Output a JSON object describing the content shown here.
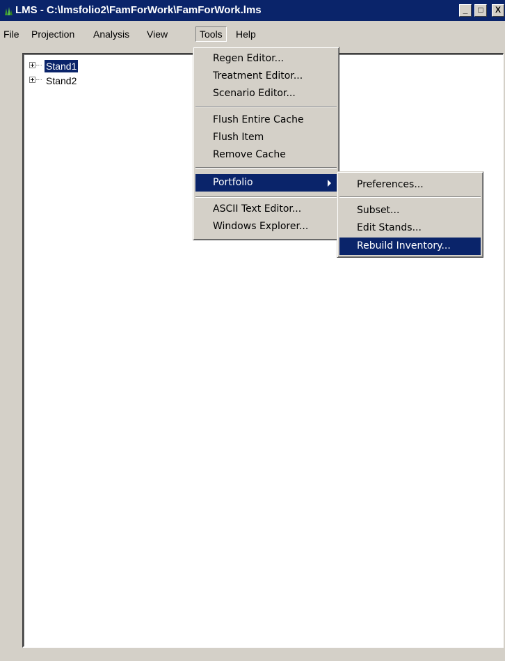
{
  "window": {
    "title": "LMS - C:\\lmsfolio2\\FamForWork\\FamForWork.lms",
    "app_icon": "lms-tree-icon",
    "minimize_label": "_",
    "maximize_label": "□",
    "close_label": "X"
  },
  "menubar": {
    "items": [
      "File",
      "Projection",
      "Analysis",
      "View",
      "Tools",
      "Help"
    ],
    "open_menu": "Tools"
  },
  "tree": {
    "nodes": [
      {
        "label": "Stand1",
        "selected": true
      },
      {
        "label": "Stand2",
        "selected": false
      }
    ]
  },
  "tools_menu": {
    "group1": [
      "Regen Editor...",
      "Treatment Editor...",
      "Scenario Editor..."
    ],
    "group2": [
      "Flush Entire Cache",
      "Flush Item",
      "Remove Cache"
    ],
    "portfolio": "Portfolio",
    "group4": [
      "ASCII Text Editor...",
      "Windows Explorer..."
    ]
  },
  "portfolio_submenu": {
    "preferences": "Preferences...",
    "items": [
      "Subset...",
      "Edit Stands...",
      "Rebuild Inventory..."
    ],
    "highlighted": "Rebuild Inventory..."
  },
  "colors": {
    "title_bar": "#0a246a",
    "highlight": "#0a246a",
    "face": "#d4d0c8"
  }
}
